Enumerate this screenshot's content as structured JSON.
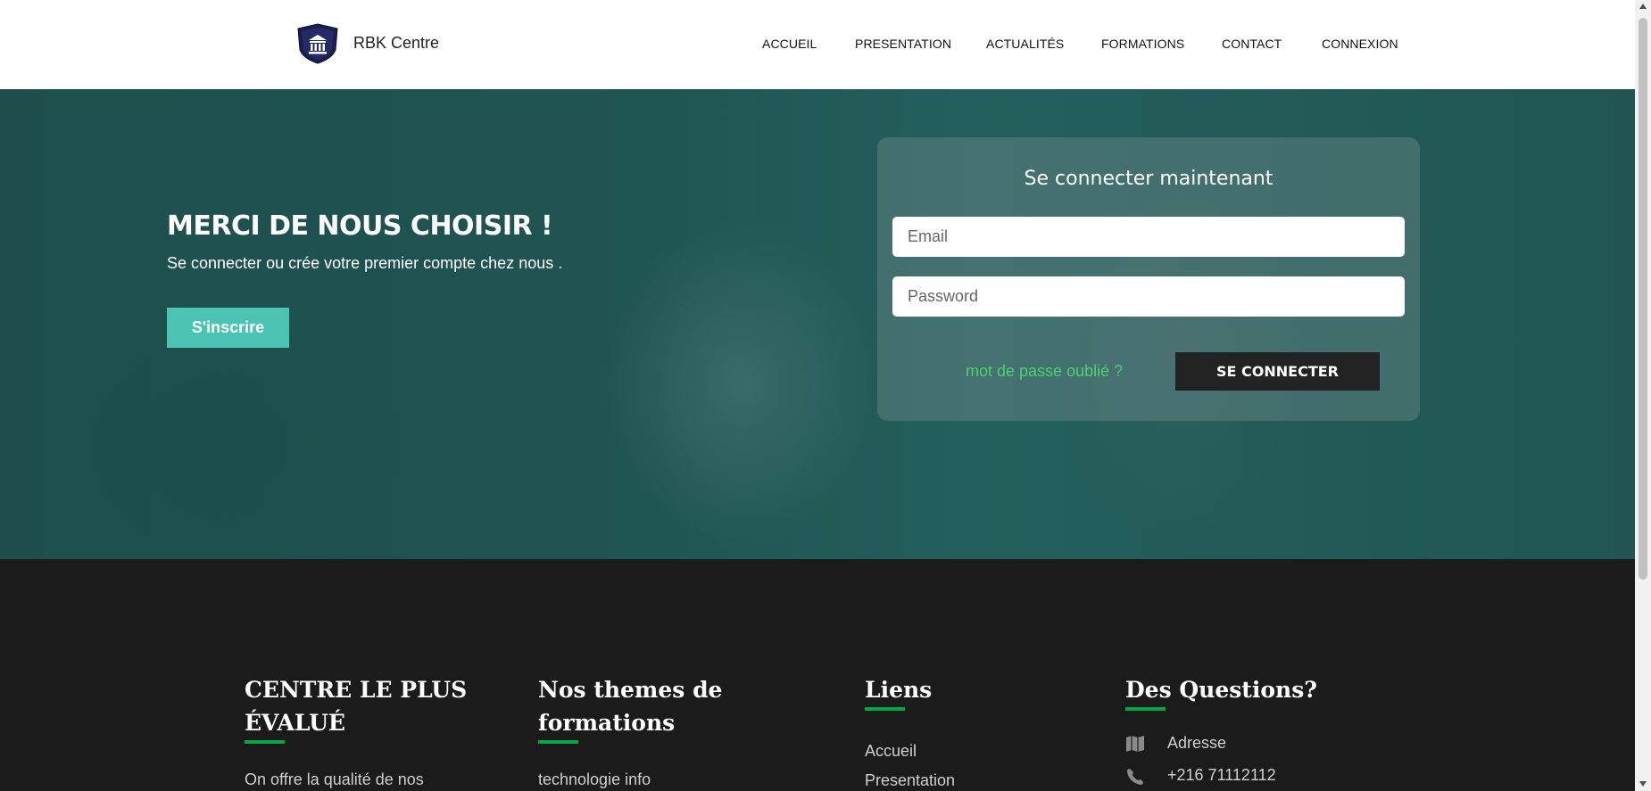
{
  "header": {
    "brand": "RBK Centre",
    "logo_icon": "bank-shield-icon",
    "nav": [
      "ACCUEIL",
      "PRESENTATION",
      "ACTUALITÉS",
      "FORMATIONS",
      "CONTACT",
      "CONNEXION"
    ]
  },
  "hero": {
    "title": "MERCI DE NOUS CHOISIR !",
    "subtitle": "Se connecter ou crée votre premier compte chez nous .",
    "signup_label": "S'inscrire"
  },
  "login": {
    "title": "Se connecter maintenant",
    "email_placeholder": "Email",
    "password_placeholder": "Password",
    "forgot_label": "mot de passe oublié ?",
    "submit_label": "SE CONNECTER"
  },
  "footer": {
    "col1": {
      "title_line1": "CENTRE LE PLUS",
      "title_line2": "ÉVALUÉ",
      "text": "On offre la qualité de nos"
    },
    "col2": {
      "title_line1": "Nos themes de",
      "title_line2": "formations",
      "text": "technologie info"
    },
    "col3": {
      "title": "Liens",
      "link1": "Accueil",
      "link2": "Presentation"
    },
    "col4": {
      "title": "Des Questions?",
      "address": "Adresse",
      "address_icon": "map-icon",
      "phone": "+216 71112112",
      "phone_icon": "phone-icon"
    }
  },
  "colors": {
    "accent_teal": "#4bc4b4",
    "accent_green": "#00a945",
    "link_green": "#4fce72",
    "hero_bg": "#1f5553",
    "footer_bg": "#1b1b1b"
  }
}
